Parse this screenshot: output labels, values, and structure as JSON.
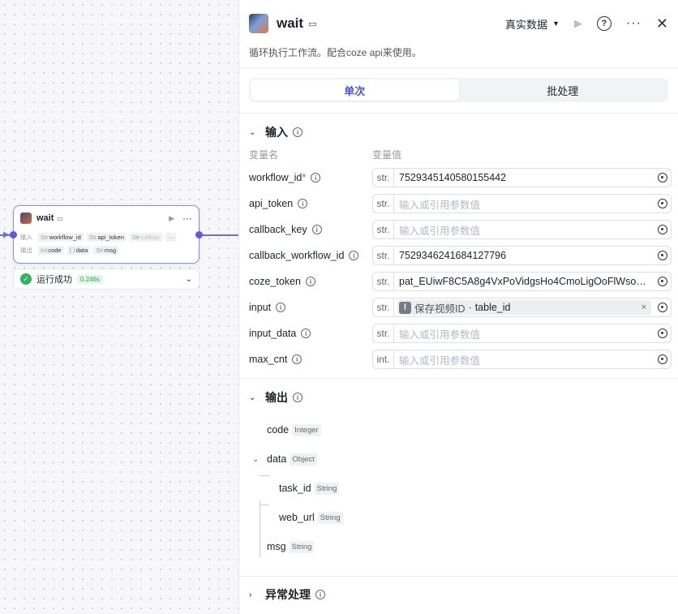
{
  "canvas_node": {
    "title": "wait",
    "input_label": "输入",
    "output_label": "输出",
    "inputs": [
      {
        "type": "Str",
        "name": "workflow_id"
      },
      {
        "type": "Str",
        "name": "api_token"
      },
      {
        "type": "Str",
        "name": "callbac"
      }
    ],
    "inputs_more": "···",
    "outputs": [
      {
        "type": "Int",
        "name": "code"
      },
      {
        "type": "{ }",
        "name": "data"
      },
      {
        "type": "Str",
        "name": "msg"
      }
    ],
    "run_status": "运行成功",
    "run_time": "0.246s"
  },
  "panel": {
    "title": "wait",
    "description": "循环执行工作流。配合coze api来使用。",
    "data_source": "真实数据",
    "tabs": [
      {
        "label": "单次",
        "active": true
      },
      {
        "label": "批处理",
        "active": false
      }
    ],
    "input_section": {
      "title": "输入",
      "col_name": "变量名",
      "col_value": "变量值",
      "rows": [
        {
          "name": "workflow_id",
          "required": "*",
          "type": "str.",
          "value": "7529345140580155442",
          "placeholder": ""
        },
        {
          "name": "api_token",
          "required": "",
          "type": "str.",
          "value": "",
          "placeholder": "输入或引用参数值"
        },
        {
          "name": "callback_key",
          "required": "",
          "type": "str.",
          "value": "",
          "placeholder": "输入或引用参数值"
        },
        {
          "name": "callback_workflow_id",
          "required": "",
          "type": "str.",
          "value": "7529346241684127796",
          "placeholder": ""
        },
        {
          "name": "coze_token",
          "required": "",
          "type": "str.",
          "value": "pat_EUiwF8C5A8g4VxPoVidgsHo4CmoLigOoFlWsog…",
          "placeholder": ""
        },
        {
          "name": "input",
          "required": "",
          "type": "str.",
          "value": "",
          "placeholder": "",
          "ref": {
            "source": "保存视频ID",
            "sep": "-",
            "field": "table_id",
            "warn": "!",
            "remove": "×"
          }
        },
        {
          "name": "input_data",
          "required": "",
          "type": "str.",
          "value": "",
          "placeholder": "输入或引用参数值"
        },
        {
          "name": "max_cnt",
          "required": "",
          "type": "int.",
          "value": "",
          "placeholder": "输入或引用参数值"
        }
      ]
    },
    "output_section": {
      "title": "输出",
      "fields": [
        {
          "name": "code",
          "type": "Integer"
        },
        {
          "name": "data",
          "type": "Object"
        },
        {
          "name": "task_id",
          "type": "String"
        },
        {
          "name": "web_url",
          "type": "String"
        },
        {
          "name": "msg",
          "type": "String"
        }
      ]
    },
    "exception_section": {
      "title": "异常处理"
    }
  },
  "icons": {
    "play": "play-icon",
    "help": "help-icon",
    "more": "more-icon",
    "close": "close-icon",
    "info": "info-icon",
    "reference": "reference-icon"
  },
  "colors": {
    "accent": "#4d53e8",
    "edge": "#6b6bf5",
    "success": "#2fb55b",
    "required": "#e5484d"
  }
}
